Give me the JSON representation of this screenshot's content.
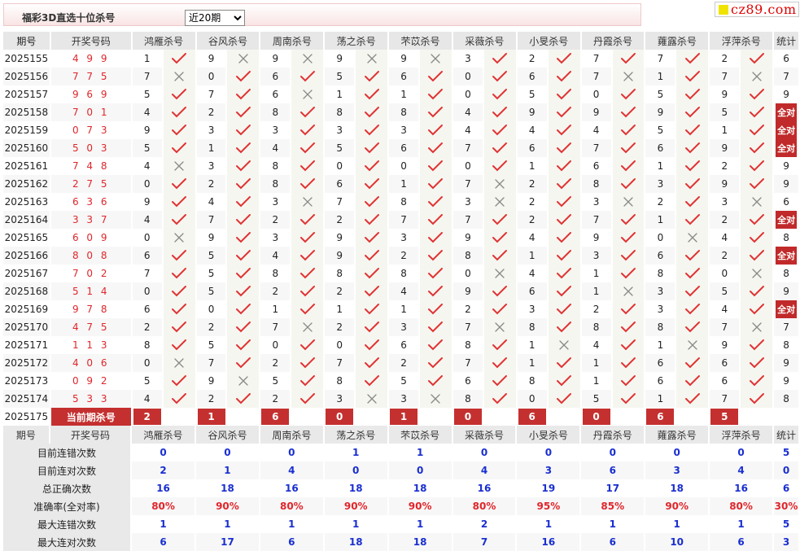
{
  "header": {
    "title": "福彩3D直选十位杀号",
    "period_select": "近20期",
    "logo": "cz89.com"
  },
  "columns": {
    "period": "期号",
    "draw": "开奖号码",
    "experts": [
      "鸿雁杀号",
      "谷风杀号",
      "周南杀号",
      "荡之杀号",
      "芣苡杀号",
      "采薇杀号",
      "小旻杀号",
      "丹霞杀号",
      "蕹露杀号",
      "浮萍杀号"
    ],
    "stat": "统计"
  },
  "all_correct_label": "全对",
  "rows": [
    {
      "period": "2025155",
      "draw": "4 9 9",
      "nums": [
        "1",
        "9",
        "9",
        "9",
        "9",
        "3",
        "2",
        "7",
        "7",
        "2"
      ],
      "res": [
        1,
        0,
        0,
        0,
        0,
        1,
        1,
        1,
        1,
        1
      ],
      "stat": "6"
    },
    {
      "period": "2025156",
      "draw": "7 7 5",
      "nums": [
        "7",
        "0",
        "6",
        "5",
        "6",
        "0",
        "6",
        "7",
        "1",
        "7"
      ],
      "res": [
        0,
        1,
        1,
        1,
        1,
        1,
        1,
        0,
        1,
        0
      ],
      "stat": "7"
    },
    {
      "period": "2025157",
      "draw": "9 6 9",
      "nums": [
        "5",
        "7",
        "6",
        "1",
        "1",
        "0",
        "5",
        "0",
        "5",
        "9"
      ],
      "res": [
        1,
        1,
        0,
        1,
        1,
        1,
        1,
        1,
        1,
        1
      ],
      "stat": "9"
    },
    {
      "period": "2025158",
      "draw": "7 0 1",
      "nums": [
        "4",
        "2",
        "8",
        "8",
        "8",
        "4",
        "9",
        "9",
        "9",
        "5"
      ],
      "res": [
        1,
        1,
        1,
        1,
        1,
        1,
        1,
        1,
        1,
        1
      ],
      "stat": "全对"
    },
    {
      "period": "2025159",
      "draw": "0 7 3",
      "nums": [
        "9",
        "3",
        "3",
        "3",
        "3",
        "4",
        "4",
        "4",
        "5",
        "1"
      ],
      "res": [
        1,
        1,
        1,
        1,
        1,
        1,
        1,
        1,
        1,
        1
      ],
      "stat": "全对"
    },
    {
      "period": "2025160",
      "draw": "5 0 3",
      "nums": [
        "5",
        "1",
        "4",
        "5",
        "6",
        "7",
        "6",
        "7",
        "6",
        "9"
      ],
      "res": [
        1,
        1,
        1,
        1,
        1,
        1,
        1,
        1,
        1,
        1
      ],
      "stat": "全对"
    },
    {
      "period": "2025161",
      "draw": "7 4 8",
      "nums": [
        "4",
        "3",
        "8",
        "0",
        "0",
        "0",
        "1",
        "6",
        "1",
        "2"
      ],
      "res": [
        0,
        1,
        1,
        1,
        1,
        1,
        1,
        1,
        1,
        1
      ],
      "stat": "9"
    },
    {
      "period": "2025162",
      "draw": "2 7 5",
      "nums": [
        "0",
        "2",
        "8",
        "6",
        "1",
        "7",
        "2",
        "8",
        "3",
        "9"
      ],
      "res": [
        1,
        1,
        1,
        1,
        1,
        0,
        1,
        1,
        1,
        1
      ],
      "stat": "9"
    },
    {
      "period": "2025163",
      "draw": "6 3 6",
      "nums": [
        "9",
        "4",
        "3",
        "7",
        "8",
        "3",
        "2",
        "3",
        "2",
        "3"
      ],
      "res": [
        1,
        1,
        0,
        1,
        1,
        0,
        1,
        0,
        1,
        0
      ],
      "stat": "6"
    },
    {
      "period": "2025164",
      "draw": "3 3 7",
      "nums": [
        "4",
        "7",
        "2",
        "2",
        "7",
        "7",
        "2",
        "7",
        "1",
        "2"
      ],
      "res": [
        1,
        1,
        1,
        1,
        1,
        1,
        1,
        1,
        1,
        1
      ],
      "stat": "全对"
    },
    {
      "period": "2025165",
      "draw": "6 0 9",
      "nums": [
        "0",
        "9",
        "3",
        "9",
        "3",
        "9",
        "4",
        "9",
        "0",
        "4"
      ],
      "res": [
        0,
        1,
        1,
        1,
        1,
        1,
        1,
        1,
        0,
        1
      ],
      "stat": "8"
    },
    {
      "period": "2025166",
      "draw": "8 0 8",
      "nums": [
        "6",
        "5",
        "4",
        "9",
        "2",
        "8",
        "1",
        "3",
        "6",
        "2"
      ],
      "res": [
        1,
        1,
        1,
        1,
        1,
        1,
        1,
        1,
        1,
        1
      ],
      "stat": "全对"
    },
    {
      "period": "2025167",
      "draw": "7 0 2",
      "nums": [
        "7",
        "5",
        "8",
        "8",
        "8",
        "0",
        "4",
        "1",
        "8",
        "0"
      ],
      "res": [
        1,
        1,
        1,
        1,
        1,
        0,
        1,
        1,
        1,
        0
      ],
      "stat": "8"
    },
    {
      "period": "2025168",
      "draw": "5 1 4",
      "nums": [
        "0",
        "5",
        "2",
        "2",
        "4",
        "9",
        "6",
        "1",
        "3",
        "5"
      ],
      "res": [
        1,
        1,
        1,
        1,
        1,
        1,
        1,
        0,
        1,
        1
      ],
      "stat": "9"
    },
    {
      "period": "2025169",
      "draw": "9 7 8",
      "nums": [
        "6",
        "0",
        "1",
        "1",
        "1",
        "2",
        "3",
        "2",
        "3",
        "4"
      ],
      "res": [
        1,
        1,
        1,
        1,
        1,
        1,
        1,
        1,
        1,
        1
      ],
      "stat": "全对"
    },
    {
      "period": "2025170",
      "draw": "4 7 5",
      "nums": [
        "2",
        "2",
        "7",
        "2",
        "3",
        "7",
        "8",
        "8",
        "8",
        "7"
      ],
      "res": [
        1,
        1,
        0,
        1,
        1,
        0,
        1,
        1,
        1,
        0
      ],
      "stat": "7"
    },
    {
      "period": "2025171",
      "draw": "1 1 3",
      "nums": [
        "8",
        "5",
        "0",
        "0",
        "6",
        "8",
        "1",
        "4",
        "1",
        "9"
      ],
      "res": [
        1,
        1,
        1,
        1,
        1,
        1,
        0,
        1,
        0,
        1
      ],
      "stat": "8"
    },
    {
      "period": "2025172",
      "draw": "4 0 6",
      "nums": [
        "0",
        "7",
        "2",
        "7",
        "2",
        "7",
        "1",
        "1",
        "6",
        "6"
      ],
      "res": [
        0,
        1,
        1,
        1,
        1,
        1,
        1,
        1,
        1,
        1
      ],
      "stat": "9"
    },
    {
      "period": "2025173",
      "draw": "0 9 2",
      "nums": [
        "5",
        "9",
        "5",
        "8",
        "5",
        "6",
        "8",
        "1",
        "6",
        "6"
      ],
      "res": [
        1,
        0,
        1,
        1,
        1,
        1,
        1,
        1,
        1,
        1
      ],
      "stat": "9"
    },
    {
      "period": "2025174",
      "draw": "5 3 3",
      "nums": [
        "4",
        "2",
        "2",
        "3",
        "3",
        "8",
        "0",
        "5",
        "1",
        "7"
      ],
      "res": [
        1,
        1,
        1,
        0,
        0,
        1,
        1,
        1,
        1,
        1
      ],
      "stat": "8"
    }
  ],
  "current": {
    "period": "2025175",
    "label": "当前期杀号",
    "nums": [
      "2",
      "1",
      "6",
      "0",
      "1",
      "0",
      "6",
      "0",
      "6",
      "5"
    ]
  },
  "stats": {
    "header_period": "期号",
    "header_draw": "开奖号码",
    "rows": [
      {
        "label": "目前连错次数",
        "vals": [
          "0",
          "0",
          "0",
          "1",
          "1",
          "0",
          "0",
          "0",
          "0",
          "0"
        ],
        "stat": "5"
      },
      {
        "label": "目前连对次数",
        "vals": [
          "2",
          "1",
          "4",
          "0",
          "0",
          "4",
          "3",
          "6",
          "3",
          "4"
        ],
        "stat": "0"
      },
      {
        "label": "总正确次数",
        "vals": [
          "16",
          "18",
          "16",
          "18",
          "18",
          "16",
          "19",
          "17",
          "18",
          "16"
        ],
        "stat": "6"
      },
      {
        "label": "准确率(全对率)",
        "vals": [
          "80%",
          "90%",
          "80%",
          "90%",
          "90%",
          "80%",
          "95%",
          "85%",
          "90%",
          "80%"
        ],
        "stat": "30%",
        "red": true
      },
      {
        "label": "最大连错次数",
        "vals": [
          "1",
          "1",
          "1",
          "1",
          "1",
          "2",
          "1",
          "1",
          "1",
          "1"
        ],
        "stat": "5"
      },
      {
        "label": "最大连对次数",
        "vals": [
          "6",
          "17",
          "6",
          "18",
          "18",
          "7",
          "16",
          "6",
          "10",
          "6"
        ],
        "stat": "3"
      }
    ]
  },
  "colors": {
    "check": "#e03333",
    "cross": "#888888",
    "accent": "#c4302f",
    "stat_value": "#1a2fd0"
  }
}
